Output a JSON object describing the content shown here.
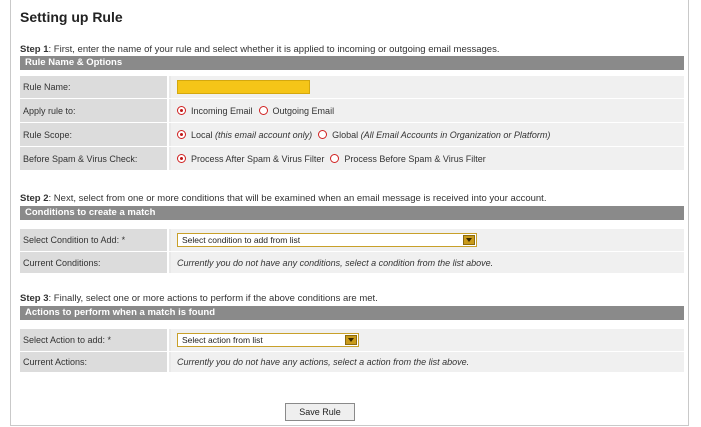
{
  "page_title": "Setting up Rule",
  "step1": {
    "label": "Step 1",
    "text": ": First, enter the name of your rule and select whether it is applied to incoming or outgoing email messages.",
    "header": "Rule Name & Options",
    "rule_name_label": "Rule Name:",
    "rule_name_value": "",
    "apply_label": "Apply rule to:",
    "apply_options": [
      "Incoming Email",
      "Outgoing Email"
    ],
    "apply_selected": "Incoming Email",
    "scope_label": "Rule Scope:",
    "scope_local": "Local",
    "scope_local_note": "(this email account only)",
    "scope_global": "Global",
    "scope_global_note": "(All Email Accounts in Organization or Platform)",
    "scope_selected": "Local",
    "spam_label": "Before Spam & Virus Check:",
    "spam_options": [
      "Process After Spam & Virus Filter",
      "Process Before Spam & Virus Filter"
    ],
    "spam_selected": "Process After Spam & Virus Filter"
  },
  "step2": {
    "label": "Step 2",
    "text": ": Next, select from one or more conditions that will be examined when an email message is received into your account.",
    "header": "Conditions to create a match",
    "select_label": "Select Condition to Add: *",
    "select_value": "Select condition to add from list",
    "current_label": "Current Conditions:",
    "current_value": "Currently you do not have any conditions, select a condition from the list above."
  },
  "step3": {
    "label": "Step 3",
    "text": ": Finally, select one or more actions to perform if the above conditions are met.",
    "header": "Actions to perform when a match is found",
    "select_label": "Select Action to add: *",
    "select_value": "Select action from list",
    "current_label": "Current Actions:",
    "current_value": "Currently you do not have any actions, select a action from the list above."
  },
  "save_button": "Save Rule",
  "colors": {
    "header_bg": "#8a8a8a",
    "input_accent": "#f5c518",
    "radio": "#d02020"
  }
}
